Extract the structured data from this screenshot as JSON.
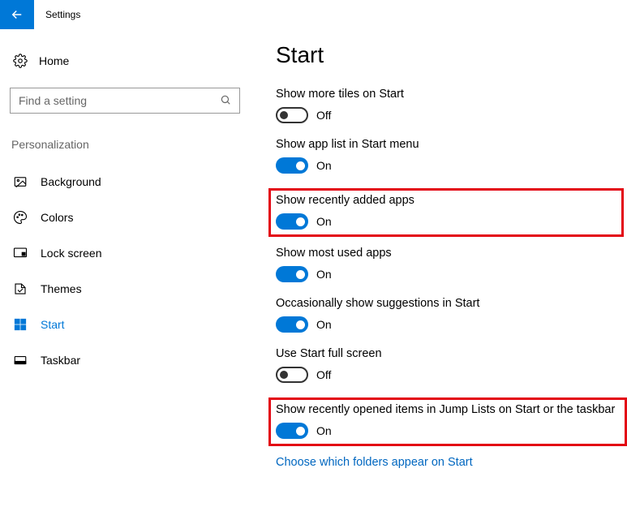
{
  "titlebar": {
    "app_title": "Settings"
  },
  "sidebar": {
    "home_label": "Home",
    "search_placeholder": "Find a setting",
    "section_label": "Personalization",
    "items": [
      {
        "label": "Background"
      },
      {
        "label": "Colors"
      },
      {
        "label": "Lock screen"
      },
      {
        "label": "Themes"
      },
      {
        "label": "Start"
      },
      {
        "label": "Taskbar"
      }
    ]
  },
  "content": {
    "title": "Start",
    "settings": [
      {
        "label": "Show more tiles on Start",
        "state": "Off"
      },
      {
        "label": "Show app list in Start menu",
        "state": "On"
      },
      {
        "label": "Show recently added apps",
        "state": "On"
      },
      {
        "label": "Show most used apps",
        "state": "On"
      },
      {
        "label": "Occasionally show suggestions in Start",
        "state": "On"
      },
      {
        "label": "Use Start full screen",
        "state": "Off"
      },
      {
        "label": "Show recently opened items in Jump Lists on Start or the taskbar",
        "state": "On"
      }
    ],
    "link": "Choose which folders appear on Start"
  }
}
